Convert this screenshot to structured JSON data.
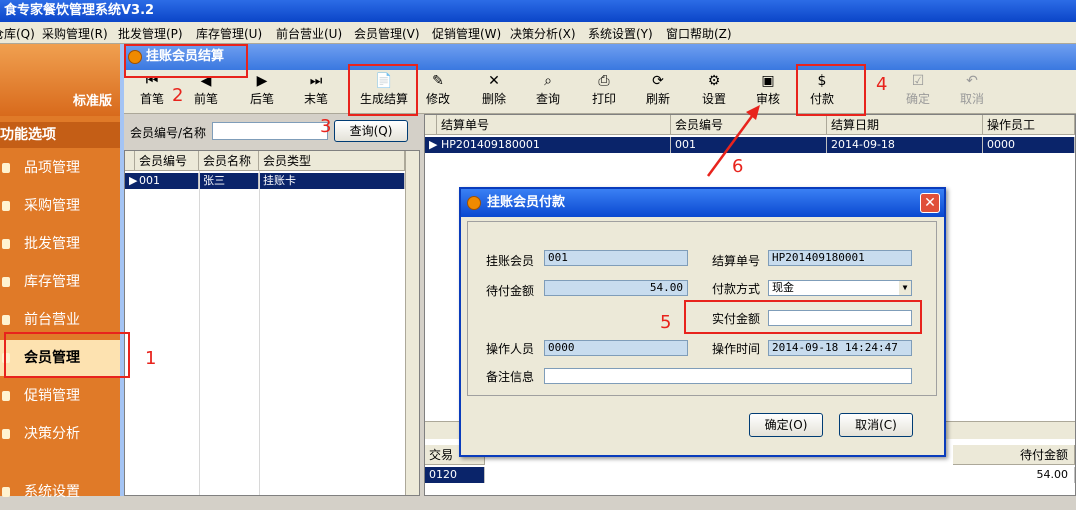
{
  "app": {
    "title": "食专家餐饮管理系统V3.2"
  },
  "menu": [
    "仓库(Q)",
    "采购管理(R)",
    "批发管理(P)",
    "库存管理(U)",
    "前台营业(U)",
    "会员管理(V)",
    "促销管理(W)",
    "决策分析(X)",
    "系统设置(Y)",
    "窗口帮助(Z)"
  ],
  "sidebar": {
    "brand": "标准版",
    "section": "功能选项",
    "items": [
      "品项管理",
      "采购管理",
      "批发管理",
      "库存管理",
      "前台营业",
      "会员管理",
      "促销管理",
      "决策分析",
      "系统设置"
    ],
    "active": "会员管理"
  },
  "window": {
    "title": "挂账会员结算"
  },
  "toolbar": {
    "first": "首笔",
    "prev": "前笔",
    "next": "后笔",
    "last": "末笔",
    "generate": "生成结算",
    "edit": "修改",
    "delete": "删除",
    "query": "查询",
    "print": "打印",
    "refresh": "刷新",
    "settings": "设置",
    "review": "审核",
    "pay": "付款",
    "confirm": "确定",
    "cancel": "取消"
  },
  "search": {
    "label": "会员编号/名称",
    "value": "",
    "button": "查询(Q)"
  },
  "member_grid": {
    "headers": [
      "会员编号",
      "会员名称",
      "会员类型"
    ],
    "rows": [
      [
        "001",
        "张三",
        "挂账卡"
      ]
    ]
  },
  "settle_grid": {
    "headers": [
      "结算单号",
      "会员编号",
      "结算日期",
      "操作员工"
    ],
    "rows": [
      [
        "HP201409180001",
        "001",
        "2014-09-18",
        "0000"
      ]
    ]
  },
  "detail_grid": {
    "headers": [
      "交易",
      "待付金额"
    ],
    "rows": [
      [
        "0120",
        "54.00"
      ]
    ]
  },
  "dialog": {
    "title": "挂账会员付款",
    "member_label": "挂账会员",
    "member_value": "001",
    "bill_label": "结算单号",
    "bill_value": "HP201409180001",
    "due_label": "待付金额",
    "due_value": "54.00",
    "method_label": "付款方式",
    "method_value": "现金",
    "paid_label": "实付金额",
    "paid_value": "",
    "operator_label": "操作人员",
    "operator_value": "0000",
    "time_label": "操作时间",
    "time_value": "2014-09-18 14:24:47",
    "note_label": "备注信息",
    "note_value": "",
    "ok": "确定(O)",
    "cancel": "取消(C)"
  },
  "annotations": {
    "n1": "1",
    "n2": "2",
    "n3": "3",
    "n4": "4",
    "n5": "5",
    "n6": "6"
  },
  "colors": {
    "highlight": "#e8231c",
    "selection": "#0a246a",
    "sidebar": "#e07a28"
  }
}
